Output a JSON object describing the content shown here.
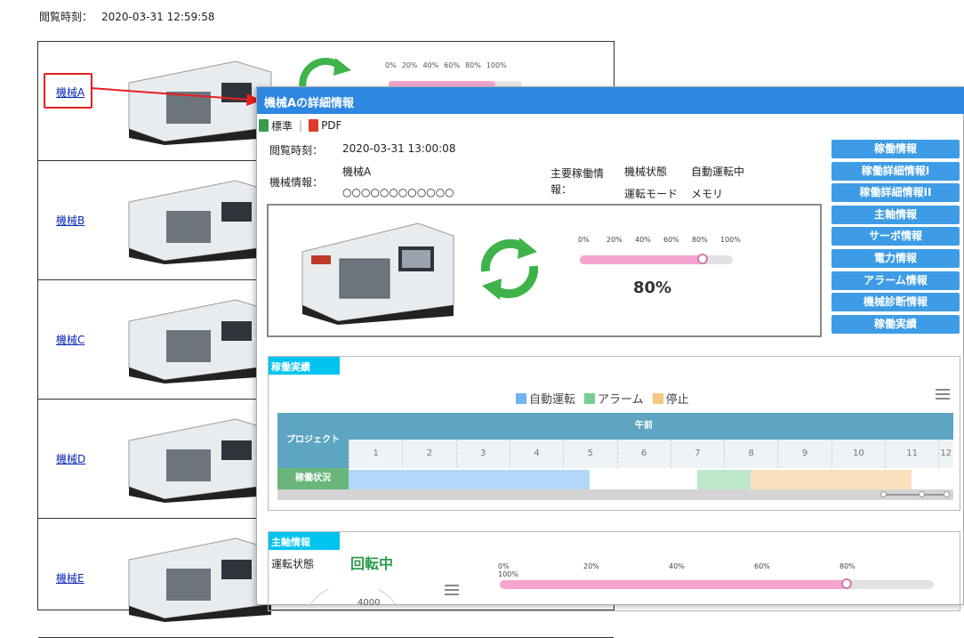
{
  "bg": {
    "time_label": "閲覧時刻：",
    "time_value": "2020-03-31 12:59:58",
    "machines": [
      "機械A",
      "機械B",
      "機械C",
      "機械D",
      "機械E"
    ],
    "mini_scale": [
      "0%",
      "20%",
      "40%",
      "60%",
      "80%",
      "100%"
    ]
  },
  "popup": {
    "title": "機械Aの詳細情報",
    "toolbar": {
      "standard_label": "標準",
      "pdf_label": "PDF"
    },
    "view_time_label": "閲覧時刻：",
    "view_time_value": "2020-03-31 13:00:08",
    "machine_info_label": "機械情報：",
    "machine_name": "機械A",
    "machine_code": "○○○○○○○○○○○○",
    "main_op_label": "主要稼働情報：",
    "machine_state_label": "機械状態",
    "machine_state_value": "自動運転中",
    "run_mode_label": "運転モード",
    "run_mode_value": "メモリ",
    "progress_scale": [
      "0%",
      "20%",
      "40%",
      "60%",
      "80%",
      "100%"
    ],
    "progress_value": 80,
    "progress_text": "80%"
  },
  "side_menu": [
    "稼働情報",
    "稼働詳細情報I",
    "稼働詳細情報II",
    "主軸情報",
    "サーボ情報",
    "電力情報",
    "アラーム情報",
    "機械診断情報",
    "稼働実績"
  ],
  "operation": {
    "tag": "稼働実績",
    "legend": [
      {
        "name": "自動運転",
        "color": "#6fb4ee"
      },
      {
        "name": "アラーム",
        "color": "#76d08f"
      },
      {
        "name": "停止",
        "color": "#f7c67f"
      }
    ],
    "project_label": "プロジェクト",
    "period_label": "午前",
    "hours": [
      "1",
      "2",
      "3",
      "4",
      "5",
      "6",
      "7",
      "8",
      "9",
      "10",
      "11",
      "12"
    ],
    "row_label": "稼働状況",
    "segments": [
      {
        "status": "自動運転",
        "start": 1,
        "end": 5.5,
        "color": "#b3d7f7"
      },
      {
        "status": "アラーム",
        "start": 7.5,
        "end": 8.5,
        "color": "#bde8c9"
      },
      {
        "status": "停止",
        "start": 8.5,
        "end": 11.5,
        "color": "#fbe0bd"
      }
    ]
  },
  "spindle": {
    "tag": "主軸情報",
    "state_label": "運転状態",
    "state_value": "回転中",
    "gauge_text": "4000",
    "scale": [
      "0%",
      "20%",
      "40%",
      "60%",
      "80%",
      "100%"
    ],
    "load_value": 80
  }
}
